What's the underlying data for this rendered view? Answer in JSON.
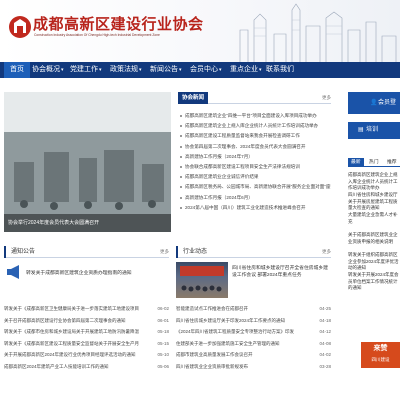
{
  "header": {
    "logo_text": "GXJK",
    "title": "成都高新区建设行业协会",
    "subtitle": "Construction Industry Association Of Chengdu High-tech Industrial Development Zone"
  },
  "nav": {
    "items": [
      {
        "label": "首页",
        "has_dropdown": false
      },
      {
        "label": "协会概况",
        "has_dropdown": true
      },
      {
        "label": "党建工作",
        "has_dropdown": true
      },
      {
        "label": "政策法规",
        "has_dropdown": true
      },
      {
        "label": "新闻公告",
        "has_dropdown": true
      },
      {
        "label": "会员中心",
        "has_dropdown": true
      },
      {
        "label": "重点企业",
        "has_dropdown": true
      },
      {
        "label": "联系我们",
        "has_dropdown": false
      }
    ]
  },
  "banner": {
    "caption": "协会举行2024年度会员代表大会圆满召开"
  },
  "news": {
    "tab": "协会新闻",
    "more": "更多",
    "items": [
      "成都高新区建筑企业“四维一平台”项目全面建设入库项目成功举办",
      "成都高新区建筑企业上规入库企业统计人员统计工作培训成功举办",
      "成都高新区建设工程质量监督站来我会开展检查调研工作",
      "协会第四届第二次理事会、2024年度会员代表大会圆满召开",
      "高新建协工作月报（2024年7月）",
      "协会联合成都高新区建设工程项目安全生产法律法规培训",
      "成都高新区建筑业企业诚信评价结果",
      "成都高新区税务局、公园城市局、高新建协联合开展“服务企业面对面”座谈",
      "高新建协工作月报（2024年6月）",
      "2024第八届中国（四川）建筑工业化建造技术推进峰会召开"
    ]
  },
  "right": {
    "login_label": "会员登录",
    "button_label": "培训",
    "tabs": [
      "最新",
      "热门",
      "推荐"
    ],
    "items": [
      "成都高新区建筑企业上规入库企业统计人员统计工作培训成功举办",
      "四川省住房和城乡建设厅关于开展房屋建筑工程质量大检查的通知",
      "大量建筑企业急需人才补充",
      "关于成都高新区建筑业企业资质申报的相关说明",
      "转发关于组织成都高新区企业参加2024年度评优活动的通知",
      "转发关于开展2024年度会员单位档案工作情况统计的通知"
    ]
  },
  "notice": {
    "title": "通知公告",
    "more": "更多",
    "featured": "转发关于成都高新区建筑企业资质办理指南的通知",
    "items": [
      {
        "title": "转发关于《成都高新区卫生健康局关于进一步落实建筑工地建设项目防暑降温工作的通知》",
        "date": "06-02"
      },
      {
        "title": "关于召开成都高新区建设行业协会第四届第二次理事会的通知",
        "date": "06-01"
      },
      {
        "title": "转发关于《成都市住房和城乡建设局关于开展建筑工地防汛防暑降温安全检查的通知》",
        "date": "05-18"
      },
      {
        "title": "转发关于《成都高新区建设工程质量安全监督站关于开展安全生产月活动的通知》",
        "date": "05-15"
      },
      {
        "title": "关于开展成都高新区2024年建设行业优秀项目经理评选活动的通知",
        "date": "05-10"
      },
      {
        "title": "成都高新区2024年建筑产业工人技能培训工作的通知",
        "date": "05-06"
      }
    ]
  },
  "dynamics": {
    "title": "行业动态",
    "more": "更多",
    "featured": "四川省住房和城乡建设厅召开全省住房城乡建设工作会议 部署2024年重点任务",
    "items": [
      {
        "title": "智能建造试点工作推进会在成都召开",
        "date": "04-25"
      },
      {
        "title": "四川省住房城乡建设厅关于印发2024年工作要点的通知",
        "date": "04-18"
      },
      {
        "title": "《2024年四川省建筑工程质量安全专项整治行动方案》印发",
        "date": "04-12"
      },
      {
        "title": "住建部关于进一步加强建筑施工安全生产管理的通知",
        "date": "04-08"
      },
      {
        "title": "成都市建筑业高质量发展工作会议召开",
        "date": "04-02"
      },
      {
        "title": "四川省建筑业企业资质审批新规发布",
        "date": "03-28"
      }
    ]
  },
  "overlay": {
    "float_label": "来赞",
    "float_sub": "四川建设"
  },
  "colors": {
    "brand_red": "#b8241c",
    "nav_blue": "#12397d",
    "accent_blue": "#1a53a8"
  }
}
